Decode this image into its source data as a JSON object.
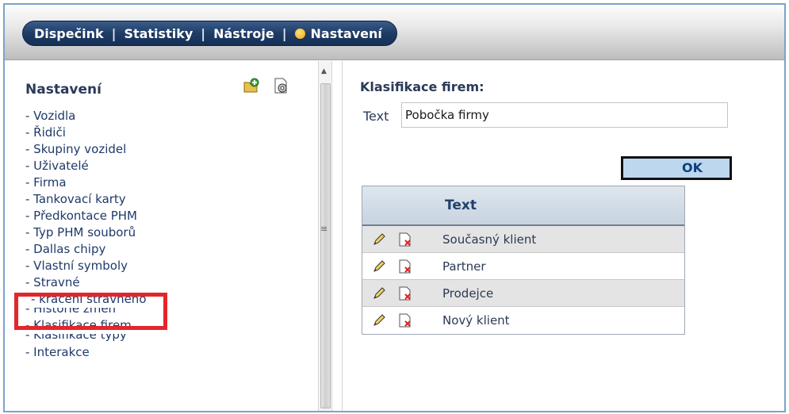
{
  "nav": {
    "items": [
      "Dispečink",
      "Statistiky",
      "Nástroje",
      "Nastavení"
    ],
    "separator": "|"
  },
  "sidebar": {
    "title": "Nastavení",
    "items": [
      {
        "label": "- Vozidla"
      },
      {
        "label": "- Řidiči"
      },
      {
        "label": "- Skupiny vozidel"
      },
      {
        "label": "- Uživatelé"
      },
      {
        "label": "- Firma"
      },
      {
        "label": "- Tankovací karty"
      },
      {
        "label": "- Předkontace PHM"
      },
      {
        "label": "- Typ PHM souborů"
      },
      {
        "label": "- Dallas chipy"
      },
      {
        "label": "- Vlastní symboly"
      },
      {
        "label": "- Stravné"
      },
      {
        "label": "- krácení stravného"
      },
      {
        "label": "- Historie změn"
      },
      {
        "label": "- Klasifikace firem"
      },
      {
        "label": "- Klasifikace typy"
      },
      {
        "label": "- Interakce"
      }
    ]
  },
  "main": {
    "title": "Klasifikace firem:",
    "text_label": "Text",
    "text_value": "Pobočka firmy",
    "ok_label": "OK",
    "table": {
      "header": "Text",
      "rows": [
        "Současný klient",
        "Partner",
        "Prodejce",
        "Nový klient"
      ]
    }
  },
  "colors": {
    "nav_bg": "#1f3c66",
    "highlight": "#e3262a",
    "ok_bg": "#bcd7ee"
  }
}
